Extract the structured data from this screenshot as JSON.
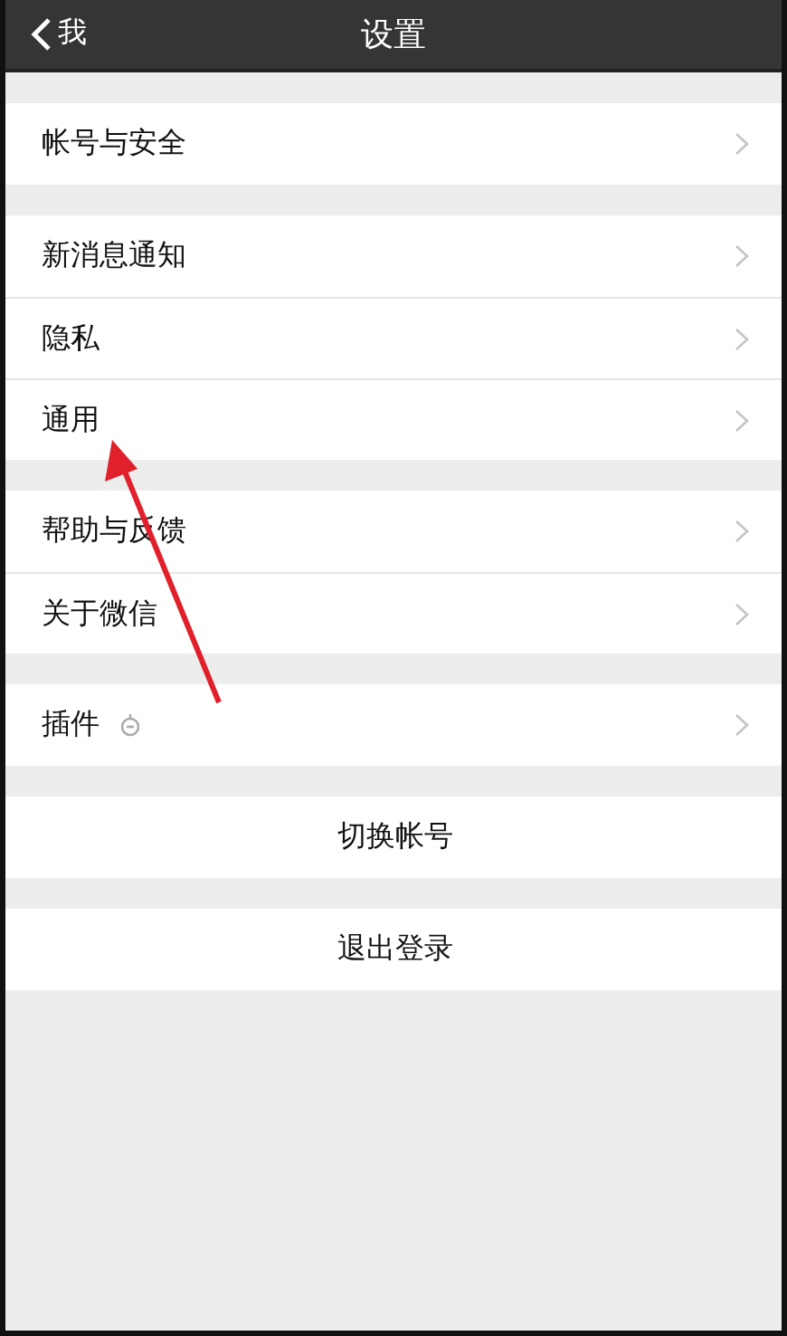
{
  "header": {
    "back_label": "我",
    "title": "设置"
  },
  "groups": [
    {
      "rows": [
        {
          "label": "帐号与安全",
          "kind": "nav"
        }
      ]
    },
    {
      "rows": [
        {
          "label": "新消息通知",
          "kind": "nav"
        },
        {
          "label": "隐私",
          "kind": "nav"
        },
        {
          "label": "通用",
          "kind": "nav"
        }
      ]
    },
    {
      "rows": [
        {
          "label": "帮助与反馈",
          "kind": "nav"
        },
        {
          "label": "关于微信",
          "kind": "nav"
        }
      ]
    },
    {
      "rows": [
        {
          "label": "插件",
          "kind": "nav_icon"
        }
      ]
    },
    {
      "rows": [
        {
          "label": "切换帐号",
          "kind": "action"
        }
      ]
    },
    {
      "rows": [
        {
          "label": "退出登录",
          "kind": "action"
        }
      ]
    }
  ],
  "annotations": [
    {
      "kind": "arrow",
      "color": "#e0202a"
    }
  ]
}
